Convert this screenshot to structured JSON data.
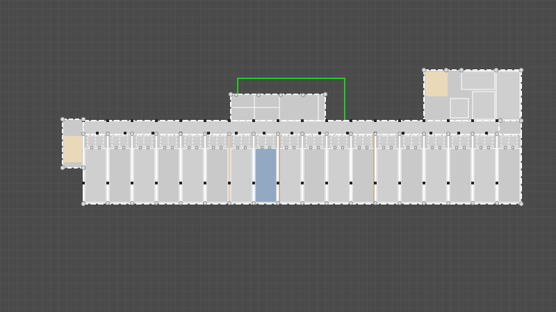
{
  "colors": {
    "background": "#4a4a4a",
    "grid_minor": "#555555",
    "grid_major": "#5e5e5e",
    "room_fill": "#c9c9c9",
    "room_fill_alt": "#cfcfcf",
    "wall": "#ffffff",
    "vertex": "#d8d8d8",
    "vertex_stroke": "#777777",
    "selected_room": "#93a9c3",
    "stair_room": "#ead9b8",
    "selection_outline": "#22cc22",
    "joint": "#222222",
    "accent_line": "#c49a6c"
  },
  "plan": {
    "view": "floor-plan-editor",
    "unit_count_south": 18,
    "unit_count_annex": 4,
    "has_selected_unit": true,
    "has_selection_outline": true
  }
}
